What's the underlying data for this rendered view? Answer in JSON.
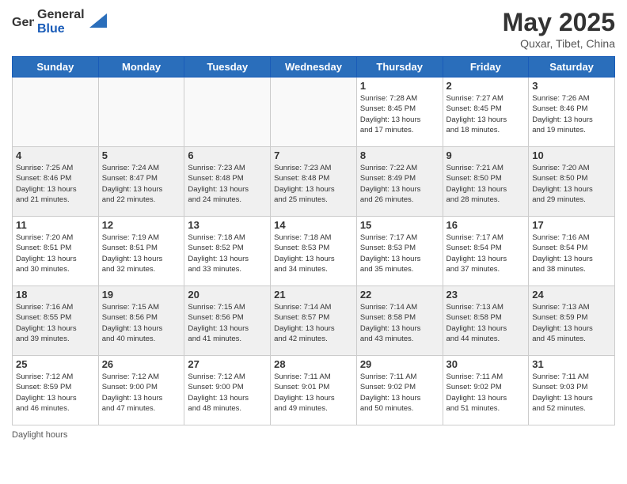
{
  "header": {
    "logo_general": "General",
    "logo_blue": "Blue",
    "title": "May 2025",
    "subtitle": "Quxar, Tibet, China"
  },
  "days_of_week": [
    "Sunday",
    "Monday",
    "Tuesday",
    "Wednesday",
    "Thursday",
    "Friday",
    "Saturday"
  ],
  "weeks": [
    [
      {
        "day": "",
        "info": ""
      },
      {
        "day": "",
        "info": ""
      },
      {
        "day": "",
        "info": ""
      },
      {
        "day": "",
        "info": ""
      },
      {
        "day": "1",
        "info": "Sunrise: 7:28 AM\nSunset: 8:45 PM\nDaylight: 13 hours\nand 17 minutes."
      },
      {
        "day": "2",
        "info": "Sunrise: 7:27 AM\nSunset: 8:45 PM\nDaylight: 13 hours\nand 18 minutes."
      },
      {
        "day": "3",
        "info": "Sunrise: 7:26 AM\nSunset: 8:46 PM\nDaylight: 13 hours\nand 19 minutes."
      }
    ],
    [
      {
        "day": "4",
        "info": "Sunrise: 7:25 AM\nSunset: 8:46 PM\nDaylight: 13 hours\nand 21 minutes."
      },
      {
        "day": "5",
        "info": "Sunrise: 7:24 AM\nSunset: 8:47 PM\nDaylight: 13 hours\nand 22 minutes."
      },
      {
        "day": "6",
        "info": "Sunrise: 7:23 AM\nSunset: 8:48 PM\nDaylight: 13 hours\nand 24 minutes."
      },
      {
        "day": "7",
        "info": "Sunrise: 7:23 AM\nSunset: 8:48 PM\nDaylight: 13 hours\nand 25 minutes."
      },
      {
        "day": "8",
        "info": "Sunrise: 7:22 AM\nSunset: 8:49 PM\nDaylight: 13 hours\nand 26 minutes."
      },
      {
        "day": "9",
        "info": "Sunrise: 7:21 AM\nSunset: 8:50 PM\nDaylight: 13 hours\nand 28 minutes."
      },
      {
        "day": "10",
        "info": "Sunrise: 7:20 AM\nSunset: 8:50 PM\nDaylight: 13 hours\nand 29 minutes."
      }
    ],
    [
      {
        "day": "11",
        "info": "Sunrise: 7:20 AM\nSunset: 8:51 PM\nDaylight: 13 hours\nand 30 minutes."
      },
      {
        "day": "12",
        "info": "Sunrise: 7:19 AM\nSunset: 8:51 PM\nDaylight: 13 hours\nand 32 minutes."
      },
      {
        "day": "13",
        "info": "Sunrise: 7:18 AM\nSunset: 8:52 PM\nDaylight: 13 hours\nand 33 minutes."
      },
      {
        "day": "14",
        "info": "Sunrise: 7:18 AM\nSunset: 8:53 PM\nDaylight: 13 hours\nand 34 minutes."
      },
      {
        "day": "15",
        "info": "Sunrise: 7:17 AM\nSunset: 8:53 PM\nDaylight: 13 hours\nand 35 minutes."
      },
      {
        "day": "16",
        "info": "Sunrise: 7:17 AM\nSunset: 8:54 PM\nDaylight: 13 hours\nand 37 minutes."
      },
      {
        "day": "17",
        "info": "Sunrise: 7:16 AM\nSunset: 8:54 PM\nDaylight: 13 hours\nand 38 minutes."
      }
    ],
    [
      {
        "day": "18",
        "info": "Sunrise: 7:16 AM\nSunset: 8:55 PM\nDaylight: 13 hours\nand 39 minutes."
      },
      {
        "day": "19",
        "info": "Sunrise: 7:15 AM\nSunset: 8:56 PM\nDaylight: 13 hours\nand 40 minutes."
      },
      {
        "day": "20",
        "info": "Sunrise: 7:15 AM\nSunset: 8:56 PM\nDaylight: 13 hours\nand 41 minutes."
      },
      {
        "day": "21",
        "info": "Sunrise: 7:14 AM\nSunset: 8:57 PM\nDaylight: 13 hours\nand 42 minutes."
      },
      {
        "day": "22",
        "info": "Sunrise: 7:14 AM\nSunset: 8:58 PM\nDaylight: 13 hours\nand 43 minutes."
      },
      {
        "day": "23",
        "info": "Sunrise: 7:13 AM\nSunset: 8:58 PM\nDaylight: 13 hours\nand 44 minutes."
      },
      {
        "day": "24",
        "info": "Sunrise: 7:13 AM\nSunset: 8:59 PM\nDaylight: 13 hours\nand 45 minutes."
      }
    ],
    [
      {
        "day": "25",
        "info": "Sunrise: 7:12 AM\nSunset: 8:59 PM\nDaylight: 13 hours\nand 46 minutes."
      },
      {
        "day": "26",
        "info": "Sunrise: 7:12 AM\nSunset: 9:00 PM\nDaylight: 13 hours\nand 47 minutes."
      },
      {
        "day": "27",
        "info": "Sunrise: 7:12 AM\nSunset: 9:00 PM\nDaylight: 13 hours\nand 48 minutes."
      },
      {
        "day": "28",
        "info": "Sunrise: 7:11 AM\nSunset: 9:01 PM\nDaylight: 13 hours\nand 49 minutes."
      },
      {
        "day": "29",
        "info": "Sunrise: 7:11 AM\nSunset: 9:02 PM\nDaylight: 13 hours\nand 50 minutes."
      },
      {
        "day": "30",
        "info": "Sunrise: 7:11 AM\nSunset: 9:02 PM\nDaylight: 13 hours\nand 51 minutes."
      },
      {
        "day": "31",
        "info": "Sunrise: 7:11 AM\nSunset: 9:03 PM\nDaylight: 13 hours\nand 52 minutes."
      }
    ]
  ],
  "footer": {
    "daylight_label": "Daylight hours"
  }
}
